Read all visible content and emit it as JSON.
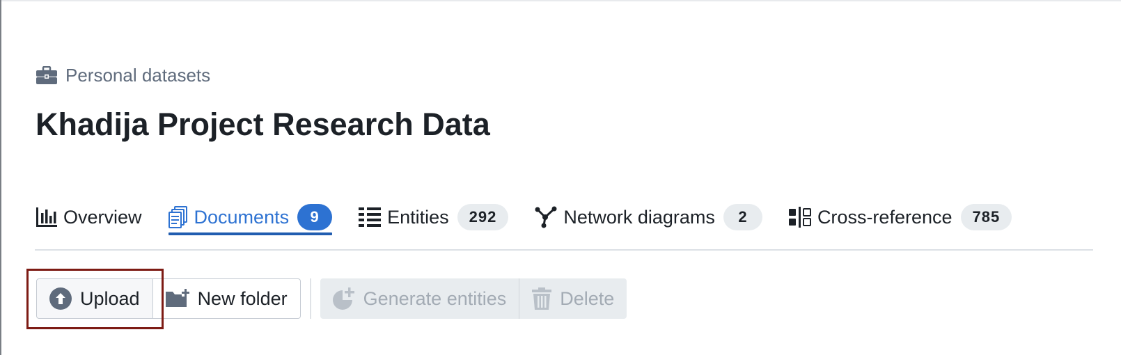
{
  "breadcrumb": {
    "label": "Personal datasets",
    "icon": "briefcase-icon"
  },
  "title": "Khadija Project Research Data",
  "tabs": [
    {
      "label": "Overview",
      "count": null,
      "icon": "bar-chart-icon",
      "active": false
    },
    {
      "label": "Documents",
      "count": "9",
      "icon": "documents-icon",
      "active": true
    },
    {
      "label": "Entities",
      "count": "292",
      "icon": "list-columns-icon",
      "active": false
    },
    {
      "label": "Network diagrams",
      "count": "2",
      "icon": "graph-icon",
      "active": false
    },
    {
      "label": "Cross-reference",
      "count": "785",
      "icon": "comparison-icon",
      "active": false
    }
  ],
  "toolbar": {
    "upload_label": "Upload",
    "new_folder_label": "New folder",
    "generate_entities_label": "Generate entities",
    "delete_label": "Delete"
  },
  "colors": {
    "accent": "#2d72d2",
    "active_underline": "#215db0",
    "focus_outline": "#7d1b14",
    "disabled_text": "#a3abb4"
  }
}
